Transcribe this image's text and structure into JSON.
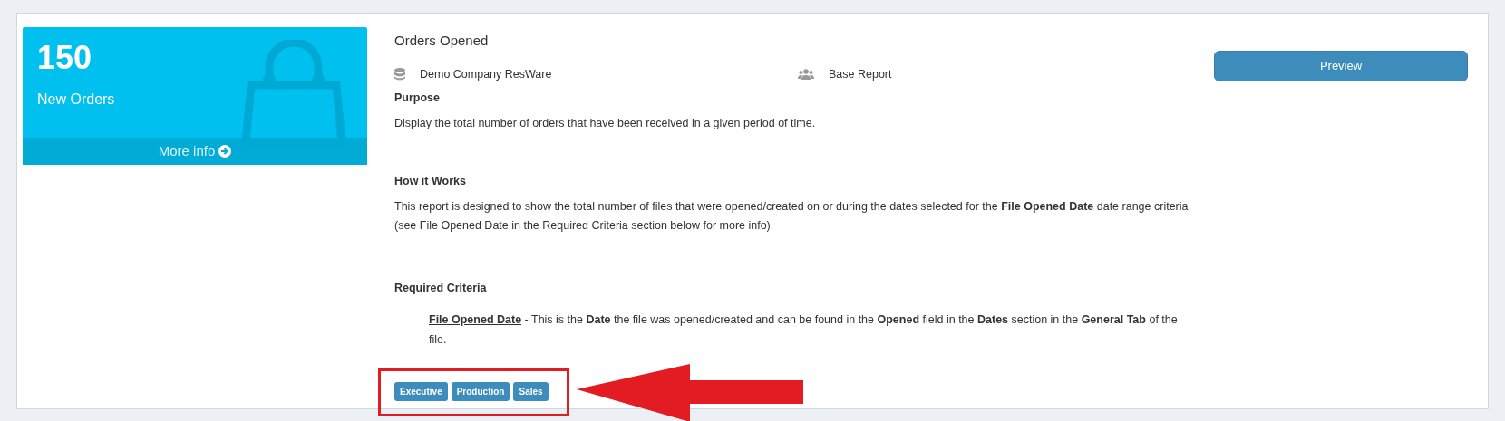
{
  "tile": {
    "count": "150",
    "label": "New Orders",
    "footer": "More info"
  },
  "report": {
    "title": "Orders Opened",
    "company": "Demo Company ResWare",
    "type": "Base Report",
    "sections": [
      {
        "heading": "Purpose",
        "text": "Display the total number of orders that have been received in a given period of time."
      },
      {
        "heading": "How it Works",
        "text": "This report is designed to show the total number of files that were opened/created on or during the dates selected for the **File Opened Date** date range criteria (see File Opened Date in the Required Criteria section below for more info)."
      }
    ],
    "criteria_heading": "Required Criteria",
    "criteria": [
      {
        "name": "File Opened Date",
        "text": " - This is the **Date** the file was opened/created and can be found in the **Opened** field in the **Dates** section in the **General Tab** of the file."
      }
    ],
    "tags": [
      "Executive",
      "Production",
      "Sales"
    ]
  },
  "action": {
    "label": "Preview"
  }
}
